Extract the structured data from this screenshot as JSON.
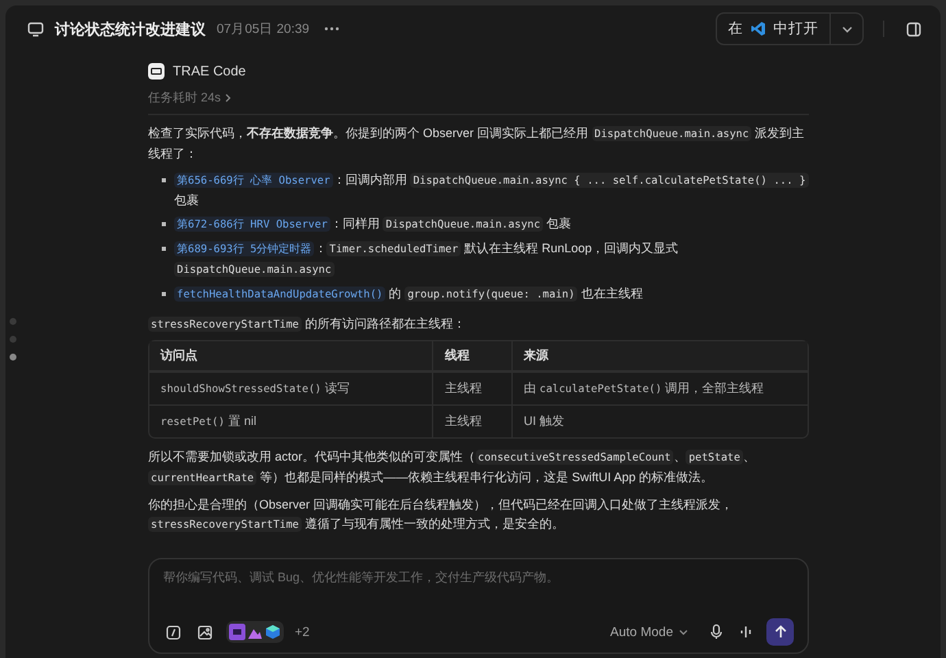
{
  "header": {
    "title": "讨论状态统计改进建议",
    "timestamp": "07月05日 20:39",
    "open_button": {
      "before": "在",
      "after": "中打开"
    }
  },
  "message": {
    "author": "TRAE Code",
    "duration": "任务耗时 24s",
    "intro": [
      {
        "kind": "text",
        "text": "检查了实际代码，"
      },
      {
        "kind": "bold",
        "text": "不存在数据竞争"
      },
      {
        "kind": "text",
        "text": "。你提到的两个 Observer 回调实际上都已经用 "
      },
      {
        "kind": "code",
        "text": "DispatchQueue.main.async"
      },
      {
        "kind": "text",
        "text": " 派发到主线程了："
      }
    ],
    "bullets": [
      [
        {
          "kind": "link",
          "text": "第656-669行 心率 Observer"
        },
        {
          "kind": "text",
          "text": "：回调内部用 "
        },
        {
          "kind": "code",
          "text": "DispatchQueue.main.async { ... self.calculatePetState() ... }"
        },
        {
          "kind": "text",
          "text": " 包裹"
        }
      ],
      [
        {
          "kind": "link",
          "text": "第672-686行 HRV Observer"
        },
        {
          "kind": "text",
          "text": "：同样用 "
        },
        {
          "kind": "code",
          "text": "DispatchQueue.main.async"
        },
        {
          "kind": "text",
          "text": " 包裹"
        }
      ],
      [
        {
          "kind": "link",
          "text": "第689-693行 5分钟定时器"
        },
        {
          "kind": "text",
          "text": "："
        },
        {
          "kind": "code",
          "text": "Timer.scheduledTimer"
        },
        {
          "kind": "text",
          "text": " 默认在主线程 RunLoop，回调内又显式 "
        },
        {
          "kind": "code",
          "text": "DispatchQueue.main.async"
        }
      ],
      [
        {
          "kind": "link",
          "text": "fetchHealthDataAndUpdateGrowth()"
        },
        {
          "kind": "text",
          "text": " 的 "
        },
        {
          "kind": "code",
          "text": "group.notify(queue: .main)"
        },
        {
          "kind": "text",
          "text": " 也在主线程"
        }
      ]
    ],
    "table_intro": [
      {
        "kind": "code",
        "text": "stressRecoveryStartTime"
      },
      {
        "kind": "text",
        "text": " 的所有访问路径都在主线程："
      }
    ],
    "table": {
      "columns": [
        "访问点",
        "线程",
        "来源"
      ],
      "rows": [
        [
          [
            {
              "kind": "mono",
              "text": "shouldShowStressedState()"
            },
            {
              "kind": "text",
              "text": " 读写"
            }
          ],
          [
            {
              "kind": "text",
              "text": "主线程"
            }
          ],
          [
            {
              "kind": "text",
              "text": "由 "
            },
            {
              "kind": "mono",
              "text": "calculatePetState()"
            },
            {
              "kind": "text",
              "text": " 调用，全部主线程"
            }
          ]
        ],
        [
          [
            {
              "kind": "mono",
              "text": "resetPet()"
            },
            {
              "kind": "text",
              "text": " 置 nil"
            }
          ],
          [
            {
              "kind": "text",
              "text": "主线程"
            }
          ],
          [
            {
              "kind": "text",
              "text": "UI 触发"
            }
          ]
        ]
      ]
    },
    "paragraphs": [
      [
        {
          "kind": "text",
          "text": "所以不需要加锁或改用 actor。代码中其他类似的可变属性（"
        },
        {
          "kind": "code",
          "text": "consecutiveStressedSampleCount"
        },
        {
          "kind": "text",
          "text": "、"
        },
        {
          "kind": "code",
          "text": "petState"
        },
        {
          "kind": "text",
          "text": "、"
        },
        {
          "kind": "code",
          "text": "currentHeartRate"
        },
        {
          "kind": "text",
          "text": " 等）也都是同样的模式——依赖主线程串行化访问，这是 SwiftUI App 的标准做法。"
        }
      ],
      [
        {
          "kind": "text",
          "text": "你的担心是合理的（Observer 回调确实可能在后台线程触发），但代码已经在回调入口处做了主线程派发，"
        },
        {
          "kind": "code",
          "text": "stressRecoveryStartTime"
        },
        {
          "kind": "text",
          "text": " 遵循了与现有属性一致的处理方式，是安全的。"
        }
      ]
    ]
  },
  "composer": {
    "placeholder": "帮你编写代码、调试 Bug、优化性能等开发工作，交付生产级代码产物。",
    "extra_count": "+2",
    "mode": "Auto Mode"
  }
}
